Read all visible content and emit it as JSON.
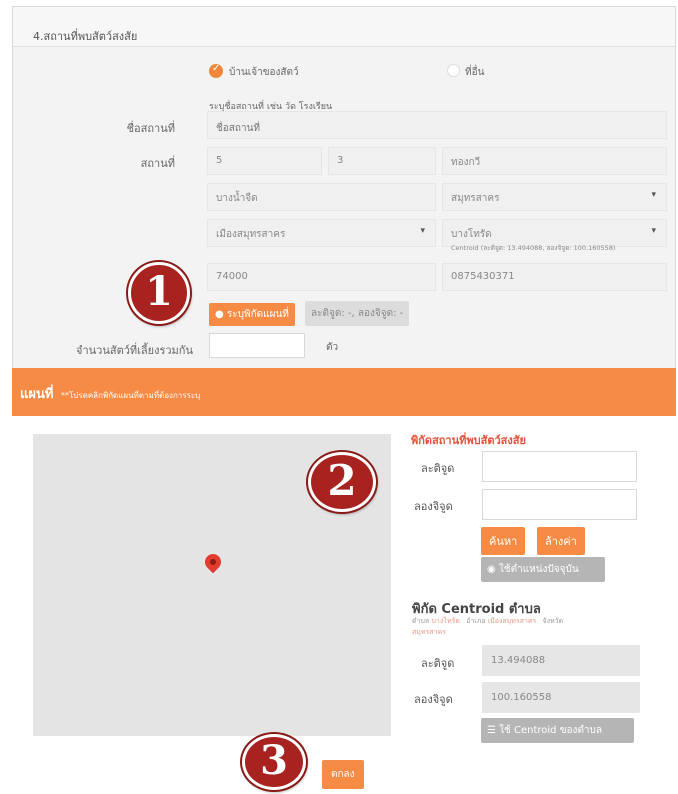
{
  "form": {
    "section_title": "4.สถานที่พบสัตว์สงสัย",
    "location_type": {
      "options": [
        {
          "label": "บ้านเจ้าของสัตว์",
          "selected": true
        },
        {
          "label": "ที่อื่น",
          "selected": false
        }
      ]
    },
    "hint": "ระบุชื่อสถานที่ เช่น วัด โรงเรียน",
    "place_name": {
      "label": "ชื่อสถานที่",
      "placeholder": "ชื่อสถานที่"
    },
    "address": {
      "label": "สถานที่",
      "house_no": "5",
      "moo": "3",
      "road": "ทองกวี",
      "subdistrict": "บางน้ำจืด",
      "province": "สมุทรสาคร",
      "district": "เมืองสมุทรสาคร",
      "subdistrict_select": "บางโทรัด",
      "centroid_note": "Centroid (ละติจูด: 13.494088, ลองจิจูด: 100.160558)",
      "postcode": "74000",
      "phone": "0875430371"
    },
    "locate_button": "ระบุพิกัดแผนที่",
    "coords_chip": "ละติจูด: -, ลองจิจูด: -",
    "animal_count": {
      "label": "จำนวนสัตว์ที่เลี้ยงรวมกัน",
      "value": "",
      "unit": "ตัว"
    }
  },
  "map": {
    "title": "แผนที่",
    "note": "**โปรดคลิกพิกัดแผนที่ตามที่ต้องการระบุ",
    "panel": {
      "coords_title": "พิกัดสถานที่พบสัตว์สงสัย",
      "lat_label": "ละติจูด",
      "lat_value": "",
      "lng_label": "ลองจิจูด",
      "lng_value": "",
      "search_button": "ค้นหา",
      "clear_button": "ล้างค่า",
      "current_location_button": "ใช้ตำแหน่งปัจจุบัน",
      "centroid_title": "พิกัด Centroid ตำบล",
      "centroid_subdistrict_label": "ตำบล",
      "centroid_subdistrict": "บางโทรัด",
      "centroid_district_label": "อำเภอ",
      "centroid_district": "เมืองสมุทรสาคร",
      "centroid_province_label": "จังหวัด",
      "centroid_province": "สมุทรสาคร",
      "centroid_lat_label": "ละติจูด",
      "centroid_lat": "13.494088",
      "centroid_lng_label": "ลองจิจูด",
      "centroid_lng": "100.160558",
      "centroid_button": "ใช้ Centroid ของตำบล"
    },
    "confirm_button": "ตกลง"
  },
  "annotations": [
    "1",
    "2",
    "3"
  ],
  "colors": {
    "accent": "#f58b45",
    "badge": "#a8231f",
    "pin": "#e23b2f"
  }
}
